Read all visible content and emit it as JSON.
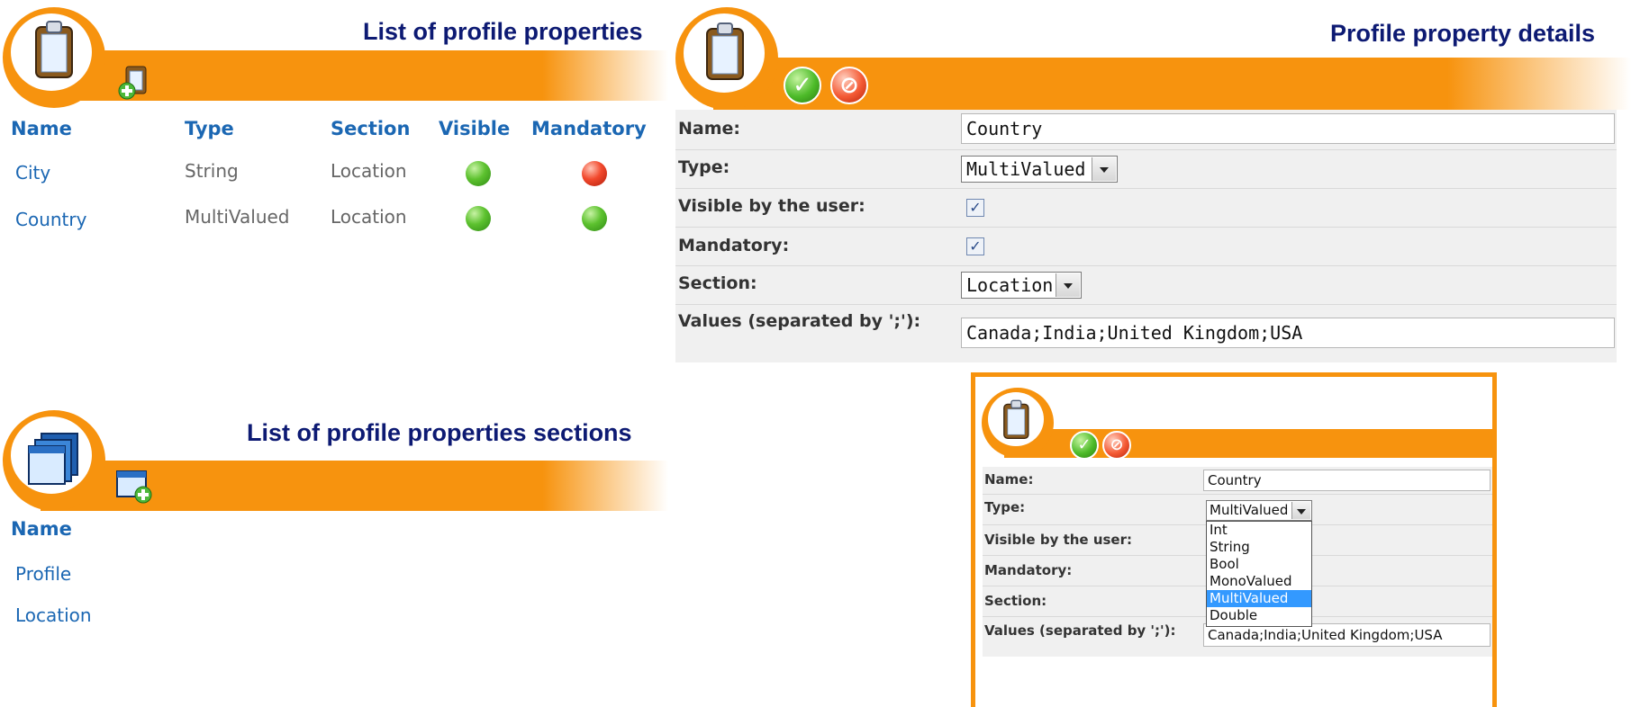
{
  "colors": {
    "accent": "#f7930e",
    "title": "#0d1a73",
    "link": "#1b67b3",
    "selected": "#3399ff"
  },
  "properties_list": {
    "title": "List of profile properties",
    "icons": {
      "main": "clipboard-icon",
      "add": "add-property-icon"
    },
    "columns": [
      "Name",
      "Type",
      "Section",
      "Visible",
      "Mandatory"
    ],
    "rows": [
      {
        "name": "City",
        "type": "String",
        "section": "Location",
        "visible": true,
        "mandatory": false
      },
      {
        "name": "Country",
        "type": "MultiValued",
        "section": "Location",
        "visible": true,
        "mandatory": true
      }
    ]
  },
  "sections_list": {
    "title": "List of profile properties sections",
    "icons": {
      "main": "windows-icon",
      "add": "add-section-icon"
    },
    "columns": [
      "Name"
    ],
    "rows": [
      "Profile",
      "Location"
    ]
  },
  "property_details": {
    "title": "Profile property details",
    "icons": {
      "main": "clipboard-icon",
      "save": "check-icon",
      "cancel": "cancel-icon"
    },
    "labels": {
      "name": "Name:",
      "type": "Type:",
      "visible": "Visible by the user:",
      "mandatory": "Mandatory:",
      "section": "Section:",
      "values": "Values (separated by ';'):"
    },
    "values": {
      "name": "Country",
      "type": "MultiValued",
      "visible": true,
      "mandatory": true,
      "section": "Location",
      "values": "Canada;India;United Kingdom;USA"
    }
  },
  "inset": {
    "labels": {
      "name": "Name:",
      "type": "Type:",
      "visible": "Visible by the user:",
      "mandatory": "Mandatory:",
      "section": "Section:",
      "values": "Values (separated by ';'):"
    },
    "values": {
      "name": "Country",
      "type": "MultiValued",
      "values": "Canada;India;United Kingdom;USA"
    },
    "type_options": [
      "Int",
      "String",
      "Bool",
      "MonoValued",
      "MultiValued",
      "Double"
    ],
    "selected_option": "MultiValued"
  }
}
